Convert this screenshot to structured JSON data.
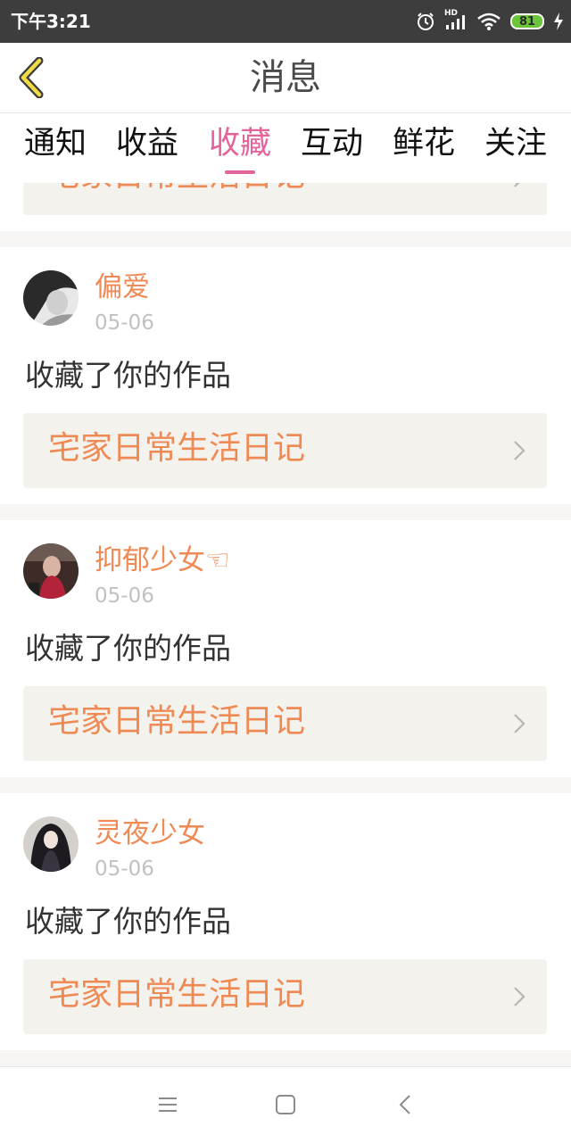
{
  "status_bar": {
    "time": "下午3:21",
    "battery": "81",
    "network": "HD"
  },
  "header": {
    "title": "消息"
  },
  "tabs": [
    {
      "label": "通知",
      "active": false
    },
    {
      "label": "收益",
      "active": false
    },
    {
      "label": "收藏",
      "active": true
    },
    {
      "label": "互动",
      "active": false
    },
    {
      "label": "鲜花",
      "active": false
    },
    {
      "label": "关注",
      "active": false
    }
  ],
  "partial_work_title": "宅家日常生活日记",
  "notifications": [
    {
      "username": "偏爱",
      "date": "05-06",
      "action": "收藏了你的作品",
      "work_title": "宅家日常生活日记"
    },
    {
      "username": "抑郁少女☜",
      "date": "05-06",
      "action": "收藏了你的作品",
      "work_title": "宅家日常生活日记"
    },
    {
      "username": "灵夜少女",
      "date": "05-06",
      "action": "收藏了你的作品",
      "work_title": "宅家日常生活日记"
    }
  ],
  "colors": {
    "accent": "#e3649a",
    "username": "#ef8a55",
    "status_bar": "#3d3d3d",
    "work_bg": "#f3f2ed"
  }
}
